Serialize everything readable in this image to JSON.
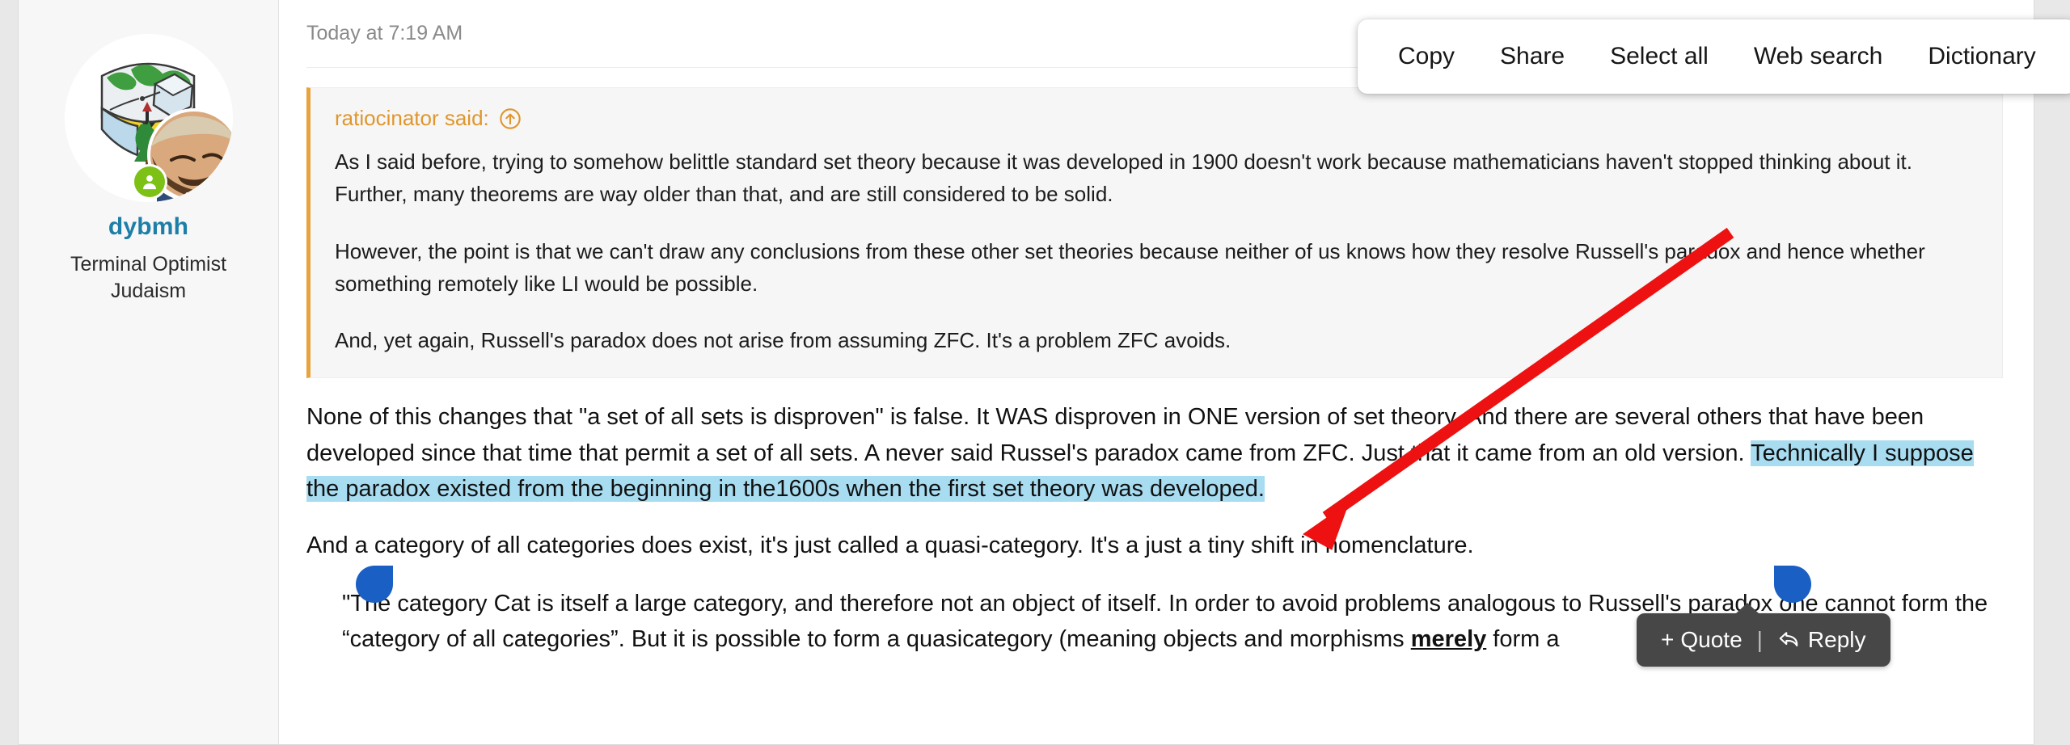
{
  "context_menu": {
    "items": [
      {
        "label": "Copy",
        "name": "copy"
      },
      {
        "label": "Share",
        "name": "share"
      },
      {
        "label": "Select all",
        "name": "select-all"
      },
      {
        "label": "Web search",
        "name": "web-search"
      },
      {
        "label": "Dictionary",
        "name": "dictionary"
      }
    ]
  },
  "post": {
    "date": "Today at 7:19 AM",
    "author": {
      "username": "dybmh",
      "title": "Terminal Optimist",
      "subtitle": "Judaism",
      "online_badge": "user-online-icon",
      "avatar": "avatar-image"
    },
    "quote": {
      "attribution": "ratiocinator said:",
      "jump_icon": "arrow-up-circle-icon",
      "paragraphs": [
        "As I said before, trying to somehow belittle standard set theory because it was developed in 1900 doesn't work because mathematicians haven't stopped thinking about it. Further, many theorems are way older than that, and are still considered to be solid.",
        "However, the point is that we can't draw any conclusions from these other set theories because neither of us knows how they resolve Russell's paradox and hence whether something remotely like LI would be possible.",
        "And, yet again, Russell's paradox does not arise from assuming ZFC. It's a problem ZFC avoids."
      ]
    },
    "body": {
      "paragraph_1_pre": "None of this changes that \"a set of all sets is disproven\" is false. It WAS disproven in ONE version of set theory. And there are several others that have been developed since that time that permit a set of all sets. A never said Russel's paradox came from ZFC. Just that it came from an old version. ",
      "paragraph_1_selected": "Technically I suppose the paradox existed from the beginning in the1600s when the first set theory was developed.",
      "paragraph_2": "And a category of all categories does exist, it's just called a quasi-category. It's a just a tiny shift in nomenclature.",
      "blockquote_pre": "\"The category Cat is itself a large category, and therefore not an object of itself. In order to avoid problems analogous to Russell's paradox one cannot form the “category of all categories”. But it is possible to form a quasicategory (meaning objects and morphisms ",
      "blockquote_bold": "merely",
      "blockquote_post": " form a"
    }
  },
  "selection_toolbar": {
    "quote_label": "Quote",
    "quote_plus": "+",
    "separator": "|",
    "reply_label": "Reply",
    "reply_icon": "reply-arrow-icon"
  },
  "colors": {
    "selection_highlight": "#a8dcf0",
    "handle_blue": "#1a5fc4",
    "quote_accent": "#e8a33d",
    "username_link": "#1d7ea8",
    "online_green": "#7dc117",
    "annotation_red": "#ee1111"
  }
}
